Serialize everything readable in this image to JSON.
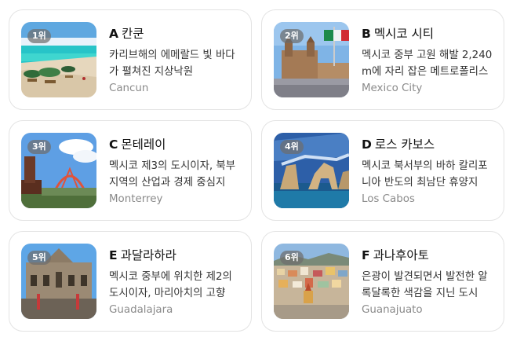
{
  "cards": [
    {
      "rank": "1위",
      "letter": "A",
      "name": "칸쿤",
      "description": "카리브해의 에메랄드 빛 바다가 펼쳐진 지상낙원",
      "english": "Cancun"
    },
    {
      "rank": "2위",
      "letter": "B",
      "name": "멕시코 시티",
      "description": "멕시코 중부 고원 해발 2,240m에 자리 잡은 메트로폴리스",
      "english": "Mexico City"
    },
    {
      "rank": "3위",
      "letter": "C",
      "name": "몬테레이",
      "description": "멕시코 제3의 도시이자, 북부 지역의 산업과 경제 중심지",
      "english": "Monterrey"
    },
    {
      "rank": "4위",
      "letter": "D",
      "name": "로스 카보스",
      "description": "멕시코 북서부의 바하 칼리포니아 반도의 최남단 휴양지",
      "english": "Los Cabos"
    },
    {
      "rank": "5위",
      "letter": "E",
      "name": "과달라하라",
      "description": "멕시코 중부에 위치한 제2의 도시이자, 마리아치의 고향",
      "english": "Guadalajara"
    },
    {
      "rank": "6위",
      "letter": "F",
      "name": "과나후아토",
      "description": "은광이 발견되면서 발전한 알록달록한 색감을 지닌 도시",
      "english": "Guanajuato"
    }
  ]
}
